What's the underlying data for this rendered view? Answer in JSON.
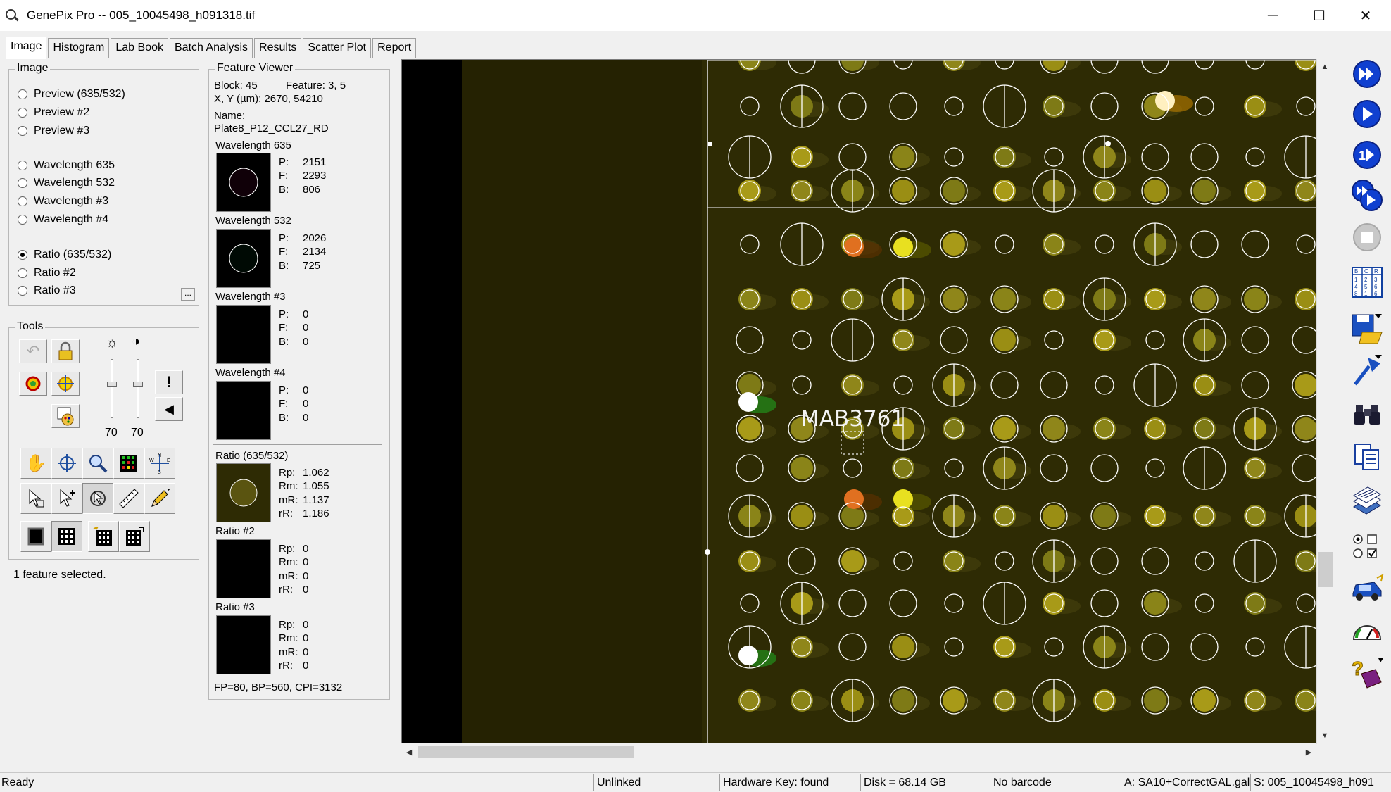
{
  "window": {
    "title": "GenePix Pro -- 005_10045498_h091318.tif",
    "minimize": "─",
    "maximize": "☐",
    "close": "✕"
  },
  "tabs": [
    {
      "label": "Image",
      "active": true
    },
    {
      "label": "Histogram",
      "active": false
    },
    {
      "label": "Lab Book",
      "active": false
    },
    {
      "label": "Batch Analysis",
      "active": false
    },
    {
      "label": "Results",
      "active": false
    },
    {
      "label": "Scatter Plot",
      "active": false
    },
    {
      "label": "Report",
      "active": false
    }
  ],
  "image_panel": {
    "title": "Image",
    "options": [
      {
        "label": "Preview (635/532)",
        "checked": false
      },
      {
        "label": "Preview #2",
        "checked": false
      },
      {
        "label": "Preview #3",
        "checked": false
      },
      {
        "label": "Wavelength 635",
        "checked": false
      },
      {
        "label": "Wavelength 532",
        "checked": false
      },
      {
        "label": "Wavelength #3",
        "checked": false
      },
      {
        "label": "Wavelength #4",
        "checked": false
      },
      {
        "label": "Ratio (635/532)",
        "checked": true
      },
      {
        "label": "Ratio #2",
        "checked": false
      },
      {
        "label": "Ratio #3",
        "checked": false
      }
    ],
    "more_button": "..."
  },
  "tools": {
    "title": "Tools",
    "brightness_value": "70",
    "contrast_value": "70"
  },
  "status_message": "1 feature selected.",
  "feature_viewer": {
    "title": "Feature Viewer",
    "block_label": "Block: 45",
    "feature_label": "Feature:  3, 5",
    "xy_label": "X, Y (µm): 2670, 54210",
    "name_label": "Name:",
    "name_value": "Plate8_P12_CCL27_RD",
    "wavelengths": [
      {
        "title": "Wavelength 635",
        "P": "2151",
        "F": "2293",
        "B": "806"
      },
      {
        "title": "Wavelength 532",
        "P": "2026",
        "F": "2134",
        "B": "725"
      },
      {
        "title": "Wavelength #3",
        "P": "0",
        "F": "0",
        "B": "0"
      },
      {
        "title": "Wavelength #4",
        "P": "0",
        "F": "0",
        "B": "0"
      }
    ],
    "ratios": [
      {
        "title": "Ratio (635/532)",
        "Rp": "1.062",
        "Rm": "1.055",
        "mR": "1.137",
        "rR": "1.186"
      },
      {
        "title": "Ratio #2",
        "Rp": "0",
        "Rm": "0",
        "mR": "0",
        "rR": "0"
      },
      {
        "title": "Ratio #3",
        "Rp": "0",
        "Rm": "0",
        "mR": "0",
        "rR": "0"
      }
    ],
    "footer": "FP=80, BP=560, CPI=3132"
  },
  "image_view": {
    "feature_label": "MAB3761",
    "background_color": "#2e2b04",
    "spot_color": "#8c8a1a",
    "circle_color": "#ffffff"
  },
  "statusbar": {
    "ready": "Ready",
    "link": "Unlinked",
    "hardware": "Hardware Key: found",
    "disk": "Disk = 68.14 GB",
    "barcode": "No barcode",
    "gal": "A: SA10+CorrectGAL.gal",
    "scan": "S: 005_10045498_h091"
  },
  "icons": {
    "app": "magnifier-icon",
    "right_toolbar": [
      "scan-fast-icon",
      "scan-icon",
      "scan-line-icon",
      "scan-multi-icon",
      "stop-icon",
      "grid-block-icon",
      "save-open-icon",
      "flag-icon",
      "binoculars-icon",
      "report-icon",
      "layers-icon",
      "options-icon",
      "car-icon",
      "gauge-icon",
      "help-book-icon"
    ]
  }
}
